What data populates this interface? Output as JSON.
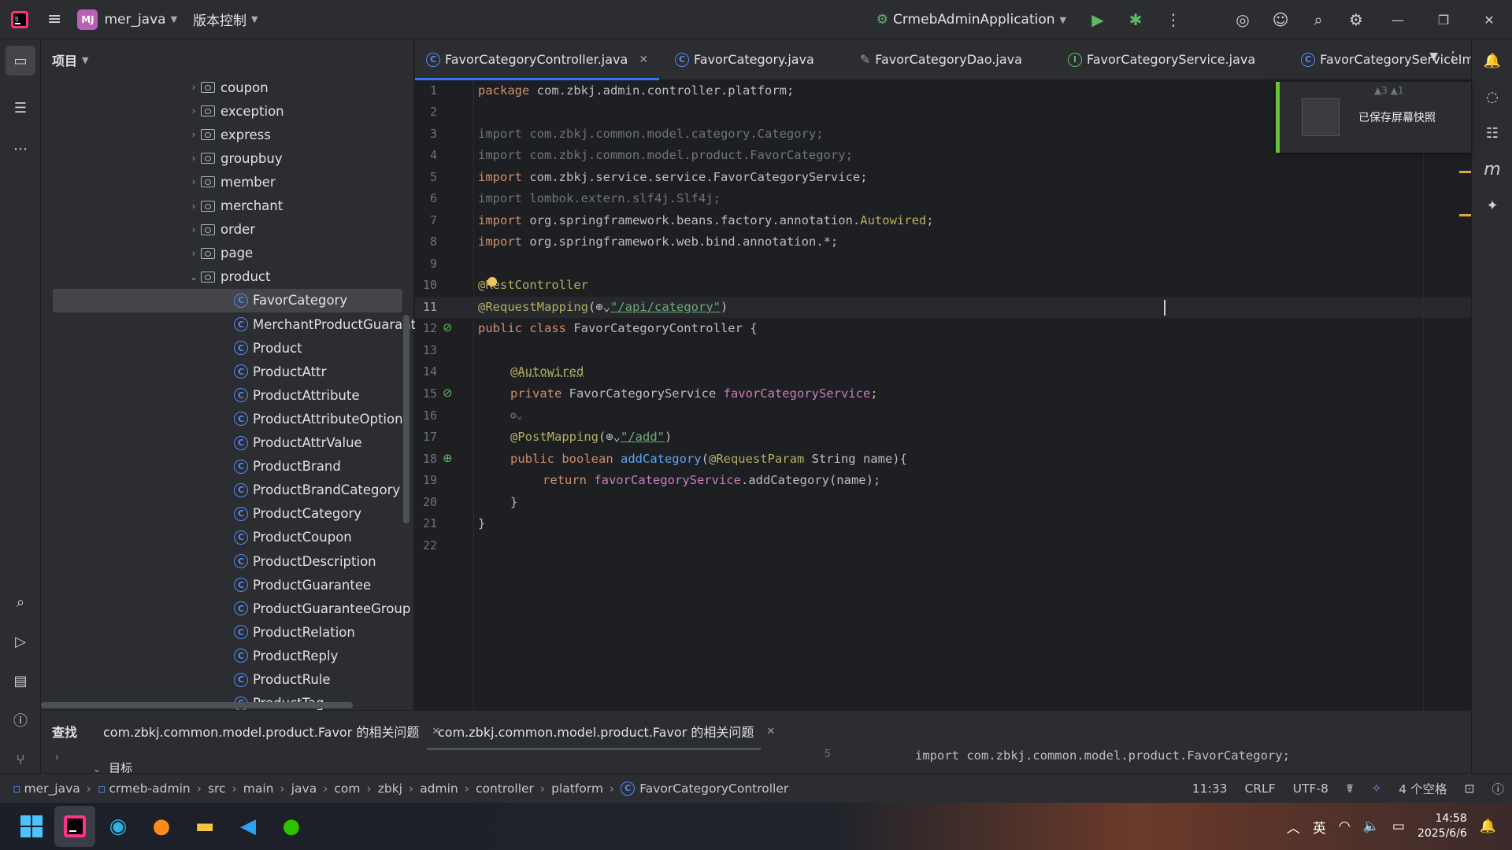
{
  "titlebar": {
    "project_badge": "MJ",
    "project_name": "mer_java",
    "vcs_label": "版本控制",
    "run_config": "CrmebAdminApplication"
  },
  "project_panel": {
    "title": "项目",
    "folders": [
      "coupon",
      "exception",
      "express",
      "groupbuy",
      "member",
      "merchant",
      "order",
      "page",
      "product"
    ],
    "classes": [
      "FavorCategory",
      "MerchantProductGuaranteeGr",
      "Product",
      "ProductAttr",
      "ProductAttribute",
      "ProductAttributeOption",
      "ProductAttrValue",
      "ProductBrand",
      "ProductBrandCategory",
      "ProductCategory",
      "ProductCoupon",
      "ProductDescription",
      "ProductGuarantee",
      "ProductGuaranteeGroup",
      "ProductRelation",
      "ProductReply",
      "ProductRule",
      "ProductTag"
    ]
  },
  "tabs": [
    {
      "label": "FavorCategoryController.java",
      "close": "✕"
    },
    {
      "label": "FavorCategory.java"
    },
    {
      "label": "FavorCategoryDao.java"
    },
    {
      "label": "FavorCategoryService.java"
    },
    {
      "label": "FavorCategoryServiceImp"
    }
  ],
  "code": {
    "line_numbers": [
      "1",
      "2",
      "3",
      "4",
      "5",
      "6",
      "7",
      "8",
      "9",
      "10",
      "11",
      "12",
      "13",
      "14",
      "15",
      "16",
      "17",
      "18",
      "19",
      "20",
      "21",
      "22"
    ],
    "l1_kw": "package",
    "l1_rest": " com.zbkj.admin.controller.platform;",
    "l3": "import com.zbkj.common.model.category.Category;",
    "l4": "import com.zbkj.common.model.product.FavorCategory;",
    "l5_kw": "import",
    "l5_rest": " com.zbkj.service.service.FavorCategoryService;",
    "l6": "import lombok.extern.slf4j.Slf4j;",
    "l7_kw": "import",
    "l7_rest": " org.springframework.beans.factory.annotation.",
    "l7_ann": "Autowired",
    "l7_end": ";",
    "l8_kw": "import",
    "l8_rest": " org.springframework.web.bind.annotation.*;",
    "l10": "@RestController",
    "l11_ann": "@RequestMapping",
    "l11_open": "(",
    "l11_str": "\"/api/category\"",
    "l11_close": ")",
    "l12_kw": "public class",
    "l12_rest": " FavorCategoryController {",
    "l14": "@Autowired",
    "l15_kw": "private",
    "l15_type": " FavorCategoryService ",
    "l15_fld": "favorCategoryService",
    "l15_end": ";",
    "l17_ann": "@PostMapping",
    "l17_open": "(",
    "l17_str": "\"/add\"",
    "l17_close": ")",
    "l18_kw": "public boolean",
    "l18_fn": " addCategory",
    "l18_open": "(",
    "l18_ann": "@RequestParam",
    "l18_rest": " String name){",
    "l19_kw": "return",
    "l19_fld": " favorCategoryService",
    "l19_rest": ".addCategory(name);",
    "l20": "}",
    "l21": "}"
  },
  "toast": {
    "text": "已保存屏幕快照",
    "warnings": "▲3 ▲1"
  },
  "bottom_panel": {
    "label": "查找",
    "tab1": "com.zbkj.common.model.product.Favor 的相关问题",
    "tab2": "com.zbkj.common.model.product.Favor 的相关问题",
    "tree_label": "目标",
    "preview_code": "import com.zbkj.common.model.product.FavorCategory;",
    "preview_line": "5"
  },
  "statusbar": {
    "breadcrumbs": [
      "mer_java",
      "crmeb-admin",
      "src",
      "main",
      "java",
      "com",
      "zbkj",
      "admin",
      "controller",
      "platform",
      "FavorCategoryController"
    ],
    "position": "11:33",
    "line_sep": "CRLF",
    "encoding": "UTF-8",
    "indent": "4 个空格"
  },
  "taskbar": {
    "ime": "英",
    "time": "14:58",
    "date": "2025/6/6"
  },
  "colors": {
    "accent": "#3574f0",
    "editor_bg": "#1e1f22",
    "panel_bg": "#2b2d30",
    "keyword": "#cf8e6d",
    "annotation": "#b3ae60",
    "string": "#6aab73",
    "field": "#c77dbb",
    "function": "#56a8f5"
  }
}
